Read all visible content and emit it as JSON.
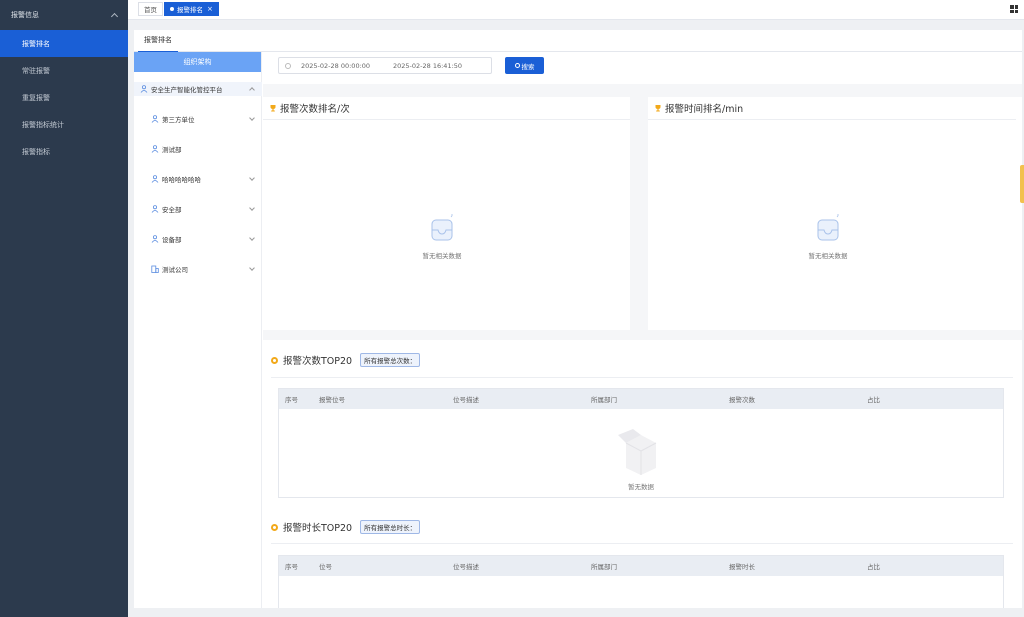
{
  "sidebar": {
    "group_title": "报警信息",
    "items": [
      {
        "label": "报警排名",
        "active": true
      },
      {
        "label": "常驻报警",
        "active": false
      },
      {
        "label": "重复报警",
        "active": false
      },
      {
        "label": "报警指标统计",
        "active": false
      },
      {
        "label": "报警指标",
        "active": false
      }
    ]
  },
  "tabs": {
    "home": "首页",
    "active": "报警排名",
    "close": "×"
  },
  "page_tab": "报警排名",
  "org": {
    "header": "组织架构",
    "root": "安全生产智能化管控平台",
    "children": [
      "第三方单位",
      "测试部",
      "哈哈哈哈哈哈",
      "安全部",
      "设备部",
      "测试公司"
    ]
  },
  "search": {
    "start": "2025-02-28 00:00:00",
    "end": "2025-02-28 16:41:50",
    "button": "搜索"
  },
  "rank_count": {
    "title": "报警次数排名/次",
    "empty": "暂无相关数据"
  },
  "rank_time": {
    "title": "报警时间排名/min",
    "empty": "暂无相关数据"
  },
  "top_count": {
    "title": "报警次数TOP20",
    "badge": "所有报警总次数：",
    "columns": [
      "序号",
      "报警位号",
      "位号描述",
      "所属部门",
      "报警次数",
      "占比"
    ],
    "empty": "暂无数据"
  },
  "top_time": {
    "title": "报警时长TOP20",
    "badge": "所有报警总时长：",
    "columns": [
      "序号",
      "位号",
      "位号描述",
      "所属部门",
      "报警时长",
      "占比"
    ]
  },
  "colors": {
    "sidebar_bg": "#2c3a4d",
    "accent": "#1a5fd6",
    "org_header": "#6aa3f5",
    "medal": "#f2a91a"
  }
}
